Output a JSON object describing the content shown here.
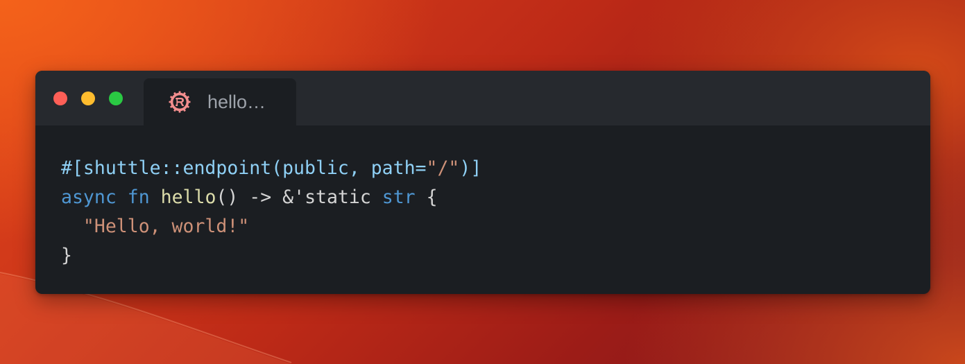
{
  "window": {
    "traffic_lights": [
      "close",
      "minimize",
      "zoom"
    ],
    "tab": {
      "icon": "rust-logo-icon",
      "label": "hello…"
    }
  },
  "colors": {
    "attribute": "#8fd0f5",
    "keyword": "#4f97d3",
    "function": "#dcdcaa",
    "string": "#ce9178",
    "text": "#d4d4d4",
    "close": "#fe5f57",
    "minimize": "#febc2e",
    "zoom": "#2ac943"
  },
  "code": {
    "line1": {
      "attr_open": "#[shuttle::endpoint(public, path=",
      "attr_str": "\"/\"",
      "attr_close": ")]"
    },
    "line2": {
      "kw_async": "async",
      "kw_fn": "fn",
      "fn_name": "hello",
      "parens_arrow": "() -> &",
      "lifetime": "'static",
      "kw_str": "str",
      "brace_open": "{"
    },
    "line3": {
      "indent": "  ",
      "string": "\"Hello, world!\""
    },
    "line4": {
      "brace_close": "}"
    }
  }
}
